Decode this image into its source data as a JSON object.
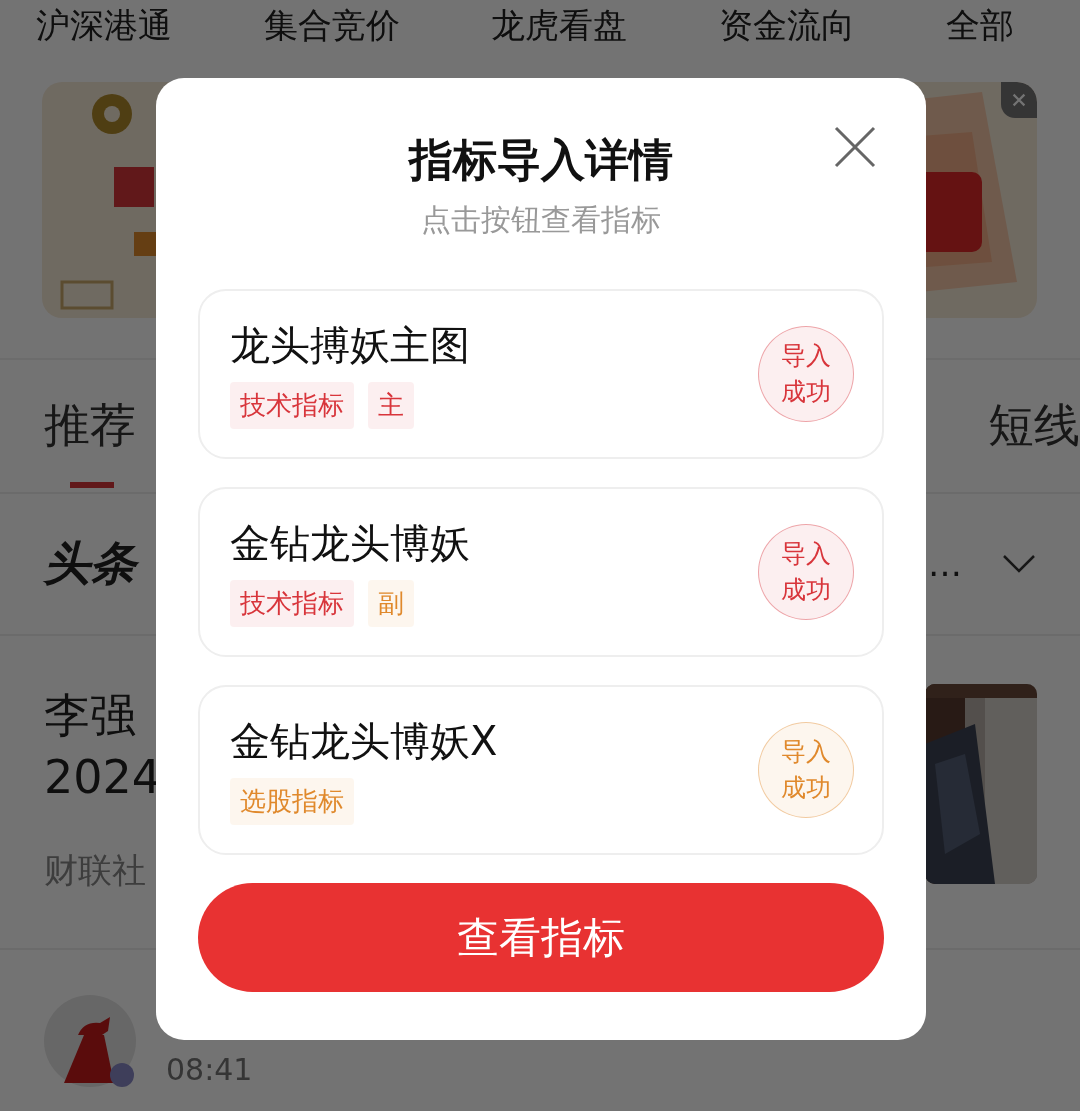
{
  "top_nav": [
    {
      "label": "沪深港通"
    },
    {
      "label": "集合竞价"
    },
    {
      "label": "龙虎看盘"
    },
    {
      "label": "资金流向"
    },
    {
      "label": "全部"
    }
  ],
  "banner": {
    "kind": "picture"
  },
  "tabs": [
    {
      "label": "推荐",
      "selected": true
    },
    {
      "label": "短线",
      "selected": false
    }
  ],
  "headline": {
    "logo": "头条",
    "more": "…"
  },
  "article": {
    "title_lines": [
      "李强",
      "2024"
    ],
    "source": "财联社",
    "thumbnail": {
      "kind": "picture"
    }
  },
  "post": {
    "time": "08:41"
  },
  "dialog": {
    "title": "指标导入详情",
    "subtitle": "点击按钮查看指标",
    "items": [
      {
        "name": "龙头搏妖主图",
        "tags": [
          {
            "label": "技术指标",
            "color": "#d8353b"
          },
          {
            "label": "主",
            "color": "#d8353b"
          }
        ],
        "status": {
          "label": "导入成功",
          "color": "#d8353b"
        }
      },
      {
        "name": "金钻龙头博妖",
        "tags": [
          {
            "label": "技术指标",
            "color": "#d8353b"
          },
          {
            "label": "副",
            "color": "#e0892c"
          }
        ],
        "status": {
          "label": "导入成功",
          "color": "#d8353b"
        }
      },
      {
        "name": "金钻龙头博妖X",
        "tags": [
          {
            "label": "选股指标",
            "color": "#e0892c"
          }
        ],
        "status": {
          "label": "导入成功",
          "color": "#e0892c"
        }
      }
    ],
    "button": "查看指标"
  }
}
